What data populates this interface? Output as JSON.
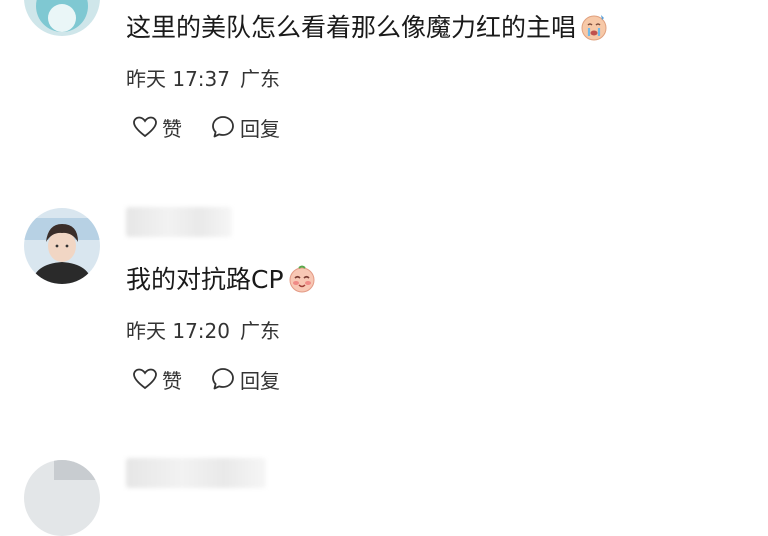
{
  "comments": [
    {
      "text": "这里的美队怎么看着那么像魔力红的主唱",
      "emoji": "crying-face-emoji",
      "time": "昨天 17:37",
      "location": "广东",
      "like_label": "赞",
      "reply_label": "回复"
    },
    {
      "text": "我的对抗路CP",
      "emoji": "blushing-face-emoji",
      "time": "昨天 17:20",
      "location": "广东",
      "like_label": "赞",
      "reply_label": "回复"
    }
  ],
  "colors": {
    "text": "#1a1a1a",
    "meta": "#333333",
    "background": "#ffffff"
  }
}
